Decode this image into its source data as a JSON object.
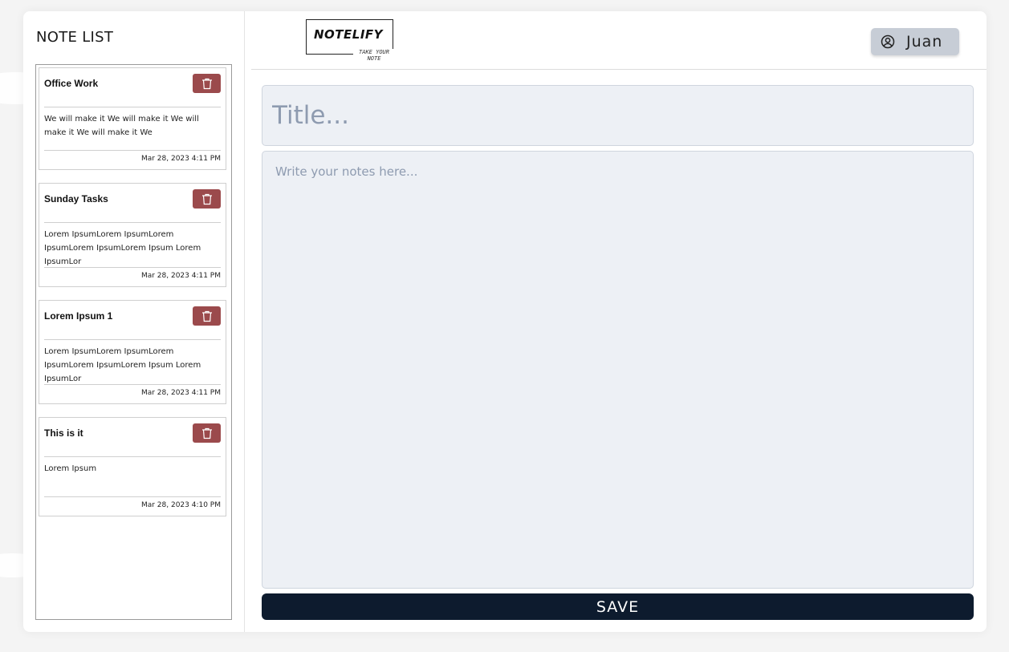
{
  "sidebar": {
    "title": "NOTE LIST",
    "notes": [
      {
        "title": "Office Work",
        "body": "We will make it We will make it We will make it We will make it We",
        "date": "Mar 28, 2023 4:11 PM"
      },
      {
        "title": "Sunday Tasks",
        "body": "Lorem IpsumLorem IpsumLorem IpsumLorem IpsumLorem Ipsum Lorem IpsumLor",
        "date": "Mar 28, 2023 4:11 PM"
      },
      {
        "title": "Lorem Ipsum 1",
        "body": "Lorem IpsumLorem IpsumLorem IpsumLorem IpsumLorem Ipsum Lorem IpsumLor",
        "date": "Mar 28, 2023 4:11 PM"
      },
      {
        "title": "This is it",
        "body": "Lorem Ipsum",
        "date": "Mar 28, 2023 4:10 PM"
      }
    ]
  },
  "header": {
    "logo_text": "NOTELIFY",
    "logo_tagline": "TAKE YOUR NOTE",
    "user_name": "Juan",
    "user_icon": "user-circle-icon"
  },
  "editor": {
    "title_placeholder": "Title...",
    "body_placeholder": "Write your notes here...",
    "save_label": "SAVE"
  },
  "colors": {
    "delete_button": "#9b4a4c",
    "save_button": "#0d1b2e",
    "input_bg": "#edf0f5",
    "user_button": "#c7cdd6"
  }
}
